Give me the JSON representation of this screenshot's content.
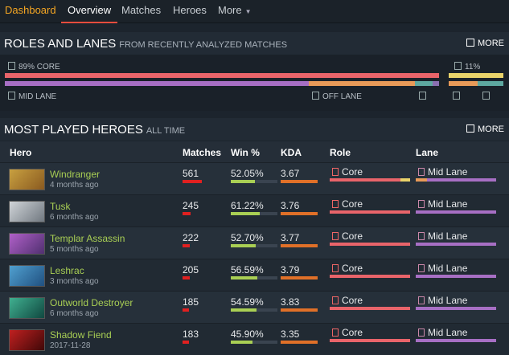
{
  "nav": {
    "brand": "Dashboard",
    "tabs": [
      "Overview",
      "Matches",
      "Heroes",
      "More"
    ]
  },
  "roles": {
    "title": "ROLES AND LANES",
    "subtitle": "FROM RECENTLY ANALYZED MATCHES",
    "more": "MORE",
    "core_label": "89% CORE",
    "support_label": "11%",
    "mid_label": "MID LANE",
    "off_label": "OFF LANE",
    "core_fraction": 0.89,
    "support_fraction": 0.11
  },
  "heroes": {
    "title": "MOST PLAYED HEROES",
    "subtitle": "ALL TIME",
    "more": "MORE",
    "columns": [
      "Hero",
      "Matches",
      "Win %",
      "KDA",
      "Role",
      "Lane"
    ],
    "rows": [
      {
        "name": "Windranger",
        "time": "4 months ago",
        "matches": "561",
        "win": "52.05%",
        "kda": "3.67",
        "role": "Core",
        "lane": "Mid Lane"
      },
      {
        "name": "Tusk",
        "time": "6 months ago",
        "matches": "245",
        "win": "61.22%",
        "kda": "3.76",
        "role": "Core",
        "lane": "Mid Lane"
      },
      {
        "name": "Templar Assassin",
        "time": "5 months ago",
        "matches": "222",
        "win": "52.70%",
        "kda": "3.77",
        "role": "Core",
        "lane": "Mid Lane"
      },
      {
        "name": "Leshrac",
        "time": "3 months ago",
        "matches": "205",
        "win": "56.59%",
        "kda": "3.79",
        "role": "Core",
        "lane": "Mid Lane"
      },
      {
        "name": "Outworld Destroyer",
        "time": "6 months ago",
        "matches": "185",
        "win": "54.59%",
        "kda": "3.83",
        "role": "Core",
        "lane": "Mid Lane"
      },
      {
        "name": "Shadow Fiend",
        "time": "2017-11-28",
        "matches": "183",
        "win": "45.90%",
        "kda": "3.35",
        "role": "Core",
        "lane": "Mid Lane"
      }
    ]
  },
  "colors": {
    "core": "#e9646a",
    "support": "#e9d36a",
    "mid": "#a76fc4",
    "off": "#e89a58",
    "safe": "#5ea8a0",
    "name_green": "#a9cf54"
  }
}
